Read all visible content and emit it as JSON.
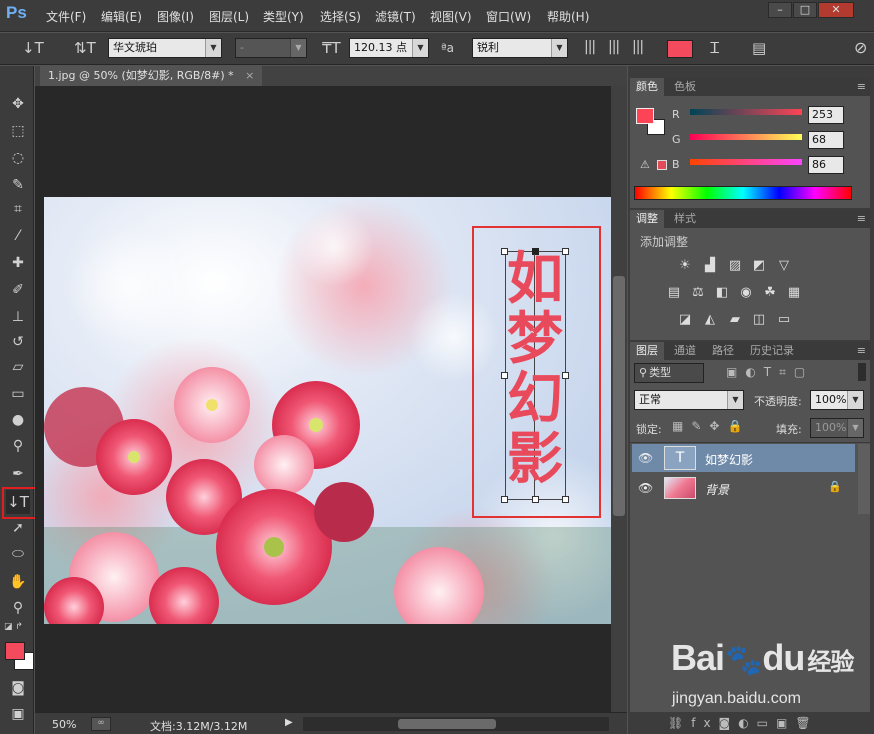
{
  "app": {
    "logo": "Ps"
  },
  "menu": [
    "文件(F)",
    "编辑(E)",
    "图像(I)",
    "图层(L)",
    "类型(Y)",
    "选择(S)",
    "滤镜(T)",
    "视图(V)",
    "窗口(W)",
    "帮助(H)"
  ],
  "options": {
    "font_family": "华文琥珀",
    "font_style": "-",
    "font_size": "120.13 点",
    "aa_label": "ªa",
    "antialias": "锐利",
    "text_color": "#f34a5d"
  },
  "document": {
    "tab_title": "1.jpg @ 50% (如梦幻影, RGB/8#) *",
    "zoom": "50%",
    "doc_info": "文档:3.12M/3.12M",
    "text_content": [
      "如",
      "梦",
      "幻",
      "影"
    ],
    "text_color": "#e94a5b"
  },
  "color_panel": {
    "tabs": [
      "颜色",
      "色板"
    ],
    "r_label": "R",
    "g_label": "G",
    "b_label": "B",
    "r": "253",
    "g": "68",
    "b": "86",
    "foreground": "#fd4456"
  },
  "adjust_panel": {
    "tabs": [
      "调整",
      "样式"
    ],
    "add_label": "添加调整"
  },
  "layers_panel": {
    "tabs": [
      "图层",
      "通道",
      "路径",
      "历史记录"
    ],
    "filter_kind": "类型",
    "blend_mode": "正常",
    "opacity_label": "不透明度:",
    "opacity": "100%",
    "lock_label": "锁定:",
    "fill_label": "填充:",
    "fill": "100%",
    "layers": [
      {
        "name": "如梦幻影",
        "type_thumb": "T"
      },
      {
        "name": "背景"
      }
    ]
  },
  "watermark": {
    "brand": "Bai",
    "brand2": "du",
    "brand3": "经验",
    "url": "jingyan.baidu.com"
  }
}
